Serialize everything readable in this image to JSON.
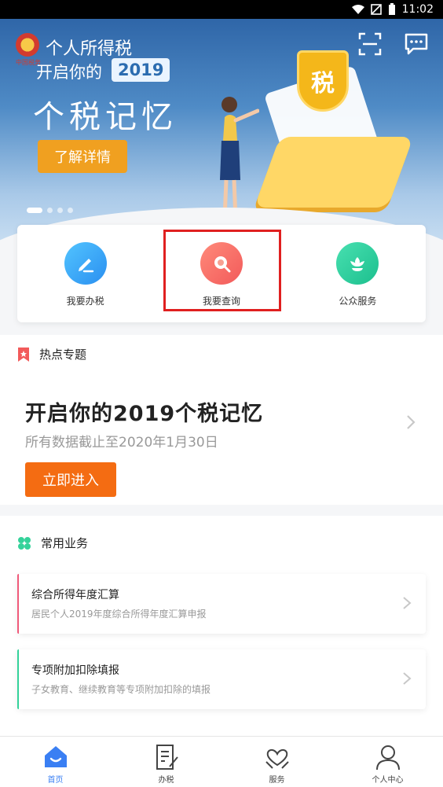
{
  "status_bar": {
    "time": "11:02",
    "icons": [
      "wifi-icon",
      "signal-icon",
      "battery-icon"
    ]
  },
  "app": {
    "title": "个人所得税",
    "emblem_caption": "中国税务"
  },
  "banner": {
    "subtitle": "开启你的",
    "year": "2019",
    "headline": "个税记忆",
    "cta": "了解详情",
    "shield_text": "税",
    "carousel": {
      "total": 4,
      "active_index": 0
    }
  },
  "quick_actions": [
    {
      "label": "我要办税",
      "icon": "pen-icon",
      "color": "#2a8ff0"
    },
    {
      "label": "我要查询",
      "icon": "search-icon",
      "color": "#f25a5a"
    },
    {
      "label": "公众服务",
      "icon": "flower-icon",
      "color": "#1cbf8e"
    }
  ],
  "hot_topics": {
    "section_title": "热点专题",
    "title": "开启你的2019个税记忆",
    "subtitle": "所有数据截止至2020年1月30日",
    "button": "立即进入"
  },
  "common_services": {
    "section_title": "常用业务",
    "items": [
      {
        "title": "综合所得年度汇算",
        "desc": "居民个人2019年度综合所得年度汇算申报",
        "accent": "#f05a7a"
      },
      {
        "title": "专项附加扣除填报",
        "desc": "子女教育、继续教育等专项附加扣除的填报",
        "accent": "#34d29a"
      }
    ]
  },
  "tab_bar": {
    "tabs": [
      {
        "label": "首页",
        "icon": "home-icon",
        "active": true
      },
      {
        "label": "办税",
        "icon": "document-icon",
        "active": false
      },
      {
        "label": "服务",
        "icon": "heart-hands-icon",
        "active": false
      },
      {
        "label": "个人中心",
        "icon": "user-icon",
        "active": false
      }
    ]
  },
  "colors": {
    "accent": "#3a7ff3",
    "orange": "#f46c12",
    "highlight": "#e02020"
  }
}
